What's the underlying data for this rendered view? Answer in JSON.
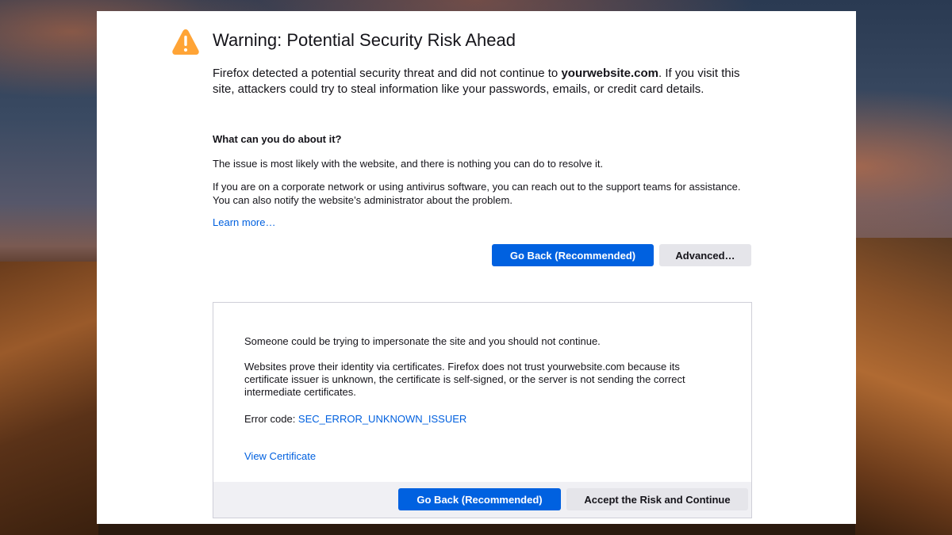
{
  "window": {
    "background": "desert dunes at dusk"
  },
  "error_page": {
    "icon": "warning-triangle-icon",
    "icon_color": "#ffa436",
    "title": "Warning: Potential Security Risk Ahead",
    "intro_before": "Firefox detected a potential security threat and did not continue to ",
    "intro_site": "yourwebsite.com",
    "intro_after": ". If you visit this site, attackers could try to steal information like your passwords, emails, or credit card details.",
    "subhead": "What can you do about it?",
    "para1": "The issue is most likely with the website, and there is nothing you can do to resolve it.",
    "para2": "If you are on a corporate network or using antivirus software, you can reach out to the support teams for assistance. You can also notify the website’s administrator about the problem.",
    "learn_more": "Learn more…",
    "go_back_label": "Go Back (Recommended)",
    "advanced_label": "Advanced…"
  },
  "advanced_panel": {
    "line1": "Someone could be trying to impersonate the site and you should not continue.",
    "line2": "Websites prove their identity via certificates. Firefox does not trust yourwebsite.com because its certificate issuer is unknown, the certificate is self-signed, or the server is not sending the correct intermediate certificates.",
    "error_label": "Error code: ",
    "error_code": "SEC_ERROR_UNKNOWN_ISSUER",
    "view_certificate": "View Certificate",
    "go_back_label": "Go Back (Recommended)",
    "accept_label": "Accept the Risk and Continue"
  },
  "colors": {
    "primary_button": "#0061e0",
    "link": "#0060df",
    "secondary_button": "#e5e5ea"
  }
}
